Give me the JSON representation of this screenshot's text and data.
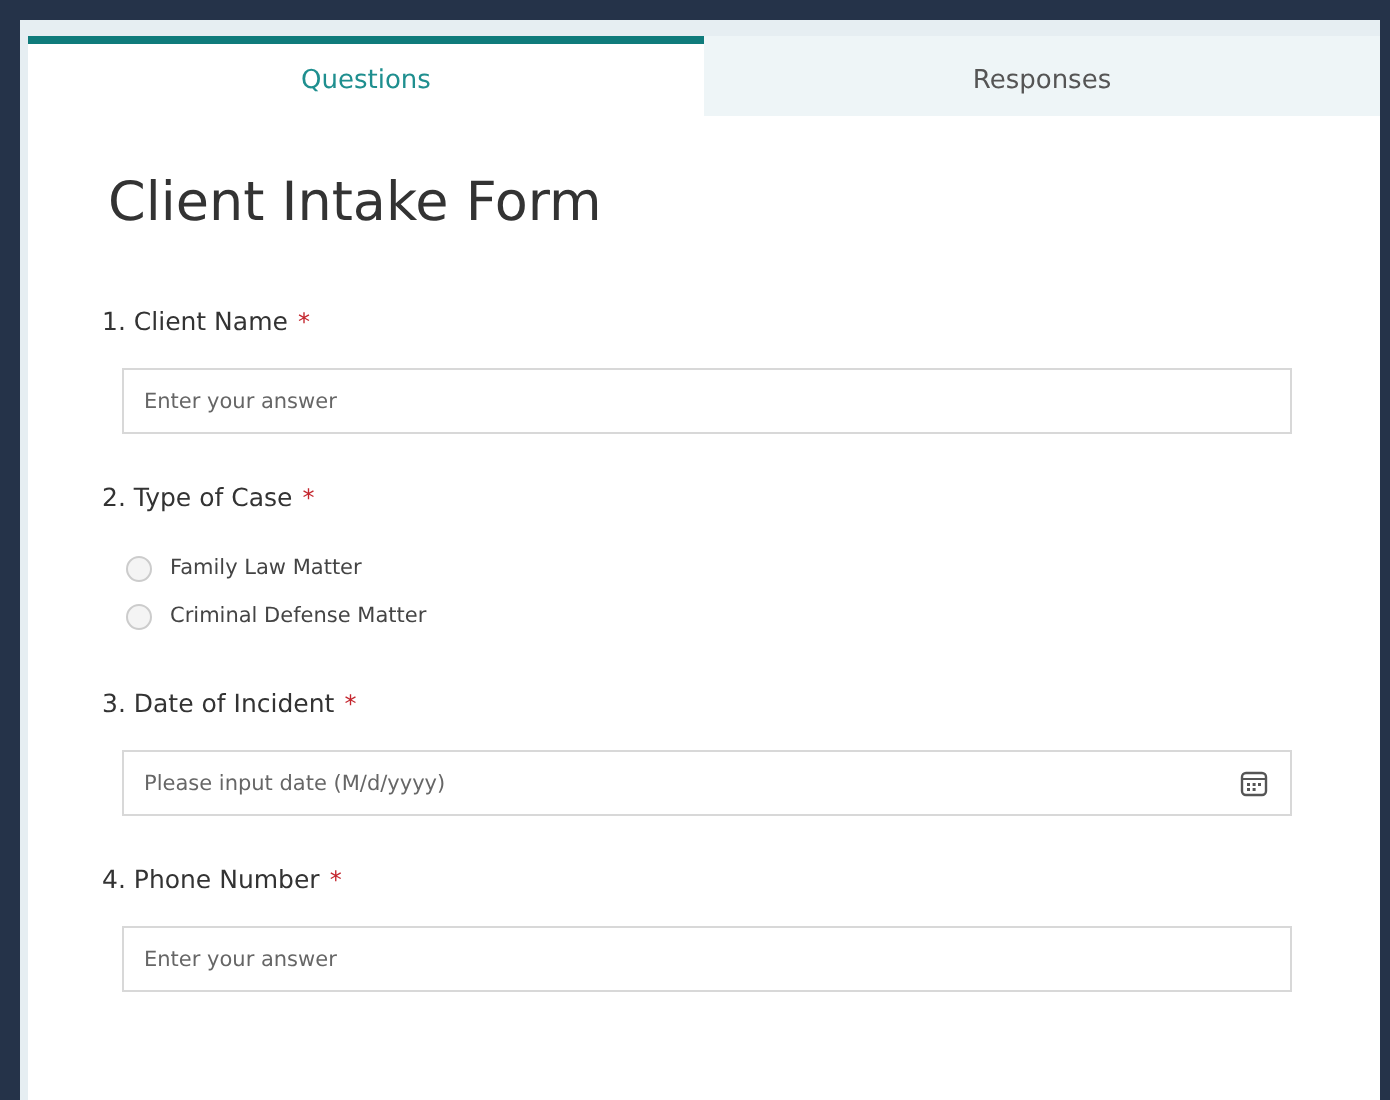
{
  "tabs": [
    {
      "label": "Questions",
      "selected": true
    },
    {
      "label": "Responses",
      "selected": false
    }
  ],
  "form": {
    "title": "Client Intake Form",
    "questions": [
      {
        "kind": "text",
        "label": "1. Client Name",
        "required_mark": "*",
        "placeholder": "Enter your answer"
      },
      {
        "kind": "choice",
        "label": "2. Type of Case",
        "required_mark": "*",
        "options": [
          {
            "label": "Family Law Matter",
            "selected": false
          },
          {
            "label": "Criminal Defense Matter",
            "selected": false
          }
        ]
      },
      {
        "kind": "date",
        "label": "3. Date of Incident",
        "required_mark": "*",
        "placeholder": "Please input date (M/d/yyyy)"
      },
      {
        "kind": "text",
        "label": "4. Phone Number",
        "required_mark": "*",
        "placeholder": "Enter your answer"
      }
    ]
  }
}
